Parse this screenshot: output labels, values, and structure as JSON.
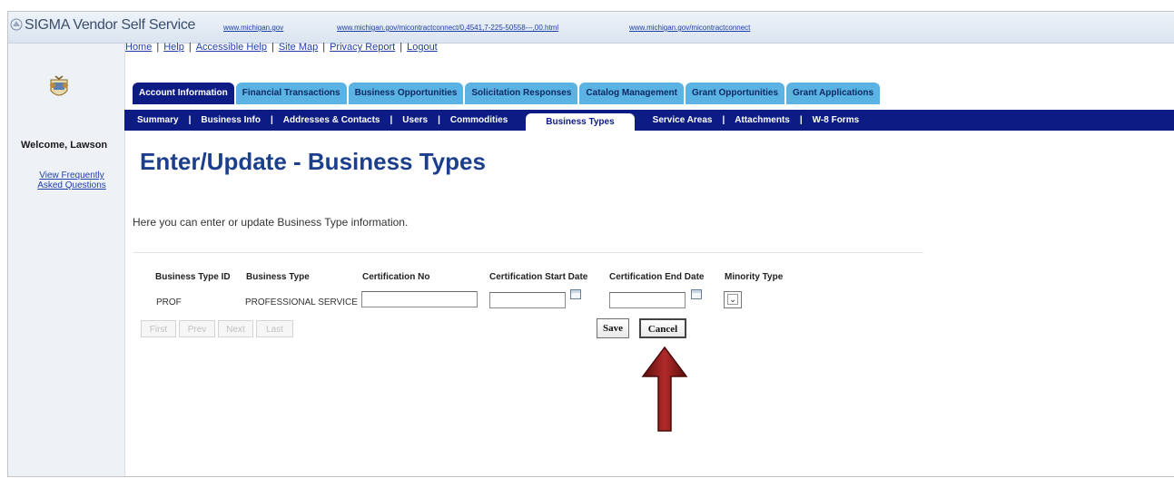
{
  "app": {
    "title": "SIGMA Vendor Self Service"
  },
  "top_links": [
    "www.michigan.gov",
    "www.michigan.gov/micontractconnect/0,4541,7-225-50558---,00.html",
    "www.michigan.gov/micontractconnect"
  ],
  "utility_links": [
    "Home",
    "Help",
    "Accessible Help",
    "Site Map",
    "Privacy Report",
    "Logout"
  ],
  "primary_tabs": [
    {
      "label": "Account Information",
      "active": true
    },
    {
      "label": "Financial Transactions"
    },
    {
      "label": "Business Opportunities"
    },
    {
      "label": "Solicitation Responses"
    },
    {
      "label": "Catalog Management"
    },
    {
      "label": "Grant Opportunities"
    },
    {
      "label": "Grant Applications"
    }
  ],
  "sub_tabs": [
    "Summary",
    "Business Info",
    "Addresses & Contacts",
    "Users",
    "Commodities",
    "Business Types",
    "Service Areas",
    "Attachments",
    "W-8 Forms"
  ],
  "active_sub_tab": "Business Types",
  "sidebar": {
    "welcome": "Welcome, Lawson",
    "faq_link": "View Frequently\nAsked Questions"
  },
  "page": {
    "title": "Enter/Update - Business Types",
    "intro": "Here you can enter or update Business Type information."
  },
  "table": {
    "headers": [
      "Business Type ID",
      "Business Type",
      "Certification No",
      "Certification Start Date",
      "Certification End Date",
      "Minority Type"
    ],
    "row": {
      "business_type_id": "PROF",
      "business_type": "PROFESSIONAL SERVICE",
      "certification_no": "",
      "start_date": "",
      "end_date": "",
      "minority_type": ""
    }
  },
  "pager": [
    "First",
    "Prev",
    "Next",
    "Last"
  ],
  "buttons": {
    "save": "Save",
    "cancel": "Cancel"
  },
  "colors": {
    "nav_dark": "#0d1c84",
    "tab_light": "#5ab3e3",
    "title": "#1c3f8c",
    "arrow": "#8b1a1a"
  },
  "icons": [
    "state-seal-icon",
    "calendar-icon",
    "chevron-down-icon",
    "up-arrow-annotation-icon"
  ]
}
